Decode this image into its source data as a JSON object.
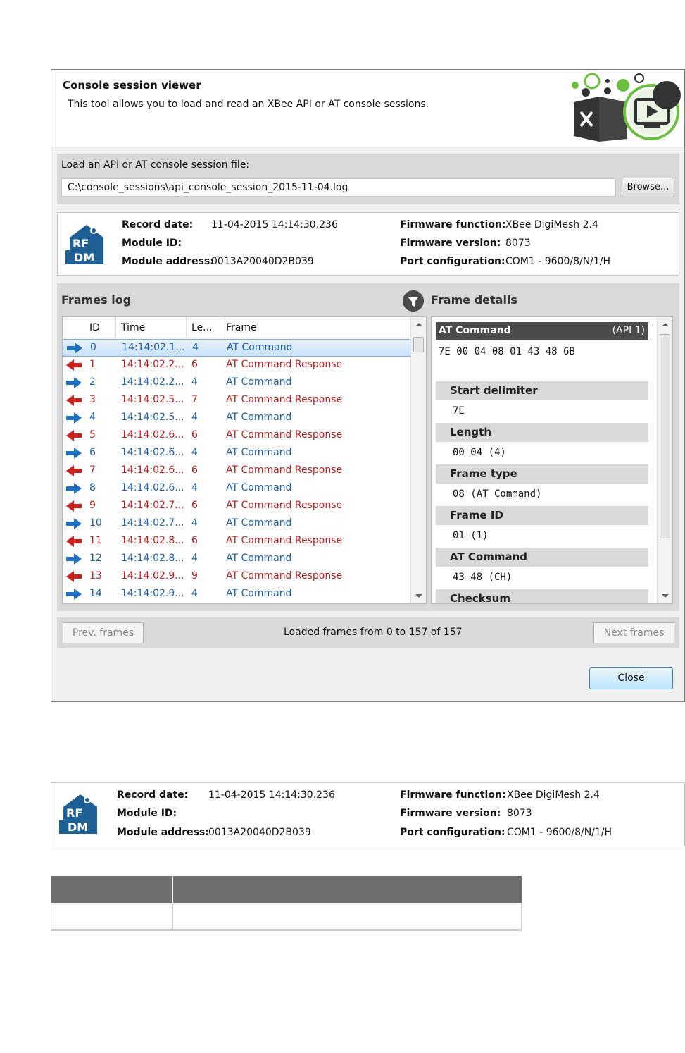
{
  "dialog": {
    "title": "Console session viewer",
    "subtitle": "This tool allows you to load and read an XBee API or AT console sessions.",
    "load_label": "Load an API or AT console session file:",
    "file_path": "C:\\console_sessions\\api_console_session_2015-11-04.log",
    "browse_label": "Browse...",
    "close_label": "Close"
  },
  "session_info": {
    "logo_text": [
      "RF",
      "DM"
    ],
    "record_date_label": "Record date:",
    "record_date": "11-04-2015 14:14:30.236",
    "module_id_label": "Module ID:",
    "module_id": "",
    "module_address_label": "Module address:",
    "module_address": "0013A20040D2B039",
    "firmware_function_label": "Firmware function:",
    "firmware_function": "XBee DigiMesh 2.4",
    "firmware_version_label": "Firmware version:",
    "firmware_version": "8073",
    "port_config_label": "Port configuration:",
    "port_config": "COM1 - 9600/8/N/1/H"
  },
  "frames_log": {
    "title": "Frames log",
    "columns": [
      "ID",
      "Time",
      "Le...",
      "Frame"
    ],
    "rows": [
      {
        "dir": "out",
        "id": "0",
        "time": "14:14:02.1...",
        "len": "4",
        "frame": "AT Command",
        "selected": true
      },
      {
        "dir": "in",
        "id": "1",
        "time": "14:14:02.2...",
        "len": "6",
        "frame": "AT Command Response"
      },
      {
        "dir": "out",
        "id": "2",
        "time": "14:14:02.2...",
        "len": "4",
        "frame": "AT Command"
      },
      {
        "dir": "in",
        "id": "3",
        "time": "14:14:02.5...",
        "len": "7",
        "frame": "AT Command Response"
      },
      {
        "dir": "out",
        "id": "4",
        "time": "14:14:02.5...",
        "len": "4",
        "frame": "AT Command"
      },
      {
        "dir": "in",
        "id": "5",
        "time": "14:14:02.6...",
        "len": "6",
        "frame": "AT Command Response"
      },
      {
        "dir": "out",
        "id": "6",
        "time": "14:14:02.6...",
        "len": "4",
        "frame": "AT Command"
      },
      {
        "dir": "in",
        "id": "7",
        "time": "14:14:02.6...",
        "len": "6",
        "frame": "AT Command Response"
      },
      {
        "dir": "out",
        "id": "8",
        "time": "14:14:02.6...",
        "len": "4",
        "frame": "AT Command"
      },
      {
        "dir": "in",
        "id": "9",
        "time": "14:14:02.7...",
        "len": "6",
        "frame": "AT Command Response"
      },
      {
        "dir": "out",
        "id": "10",
        "time": "14:14:02.7...",
        "len": "4",
        "frame": "AT Command"
      },
      {
        "dir": "in",
        "id": "11",
        "time": "14:14:02.8...",
        "len": "6",
        "frame": "AT Command Response"
      },
      {
        "dir": "out",
        "id": "12",
        "time": "14:14:02.8...",
        "len": "4",
        "frame": "AT Command"
      },
      {
        "dir": "in",
        "id": "13",
        "time": "14:14:02.9...",
        "len": "9",
        "frame": "AT Command Response"
      },
      {
        "dir": "out",
        "id": "14",
        "time": "14:14:02.9...",
        "len": "4",
        "frame": "AT Command"
      }
    ]
  },
  "frame_details": {
    "title": "Frame details",
    "header": "AT Command",
    "header_api": "(API 1)",
    "raw": "7E 00 04 08 01 43 48 6B",
    "sections": [
      {
        "label": "Start delimiter",
        "value": "7E"
      },
      {
        "label": "Length",
        "value": "00 04 (4)"
      },
      {
        "label": "Frame type",
        "value": "08 (AT Command)"
      },
      {
        "label": "Frame ID",
        "value": "01 (1)"
      },
      {
        "label": "AT Command",
        "value": "43 48 (CH)"
      },
      {
        "label": "Checksum",
        "value": ""
      }
    ]
  },
  "navigation": {
    "prev_label": "Prev. frames",
    "status": "Loaded frames from 0 to 157 of 157",
    "next_label": "Next frames"
  },
  "colors": {
    "out_arrow": "#1f6fbf",
    "in_arrow": "#c8201f",
    "panel_gray": "#d9d9d9",
    "header_dark": "#4b4b4b"
  }
}
